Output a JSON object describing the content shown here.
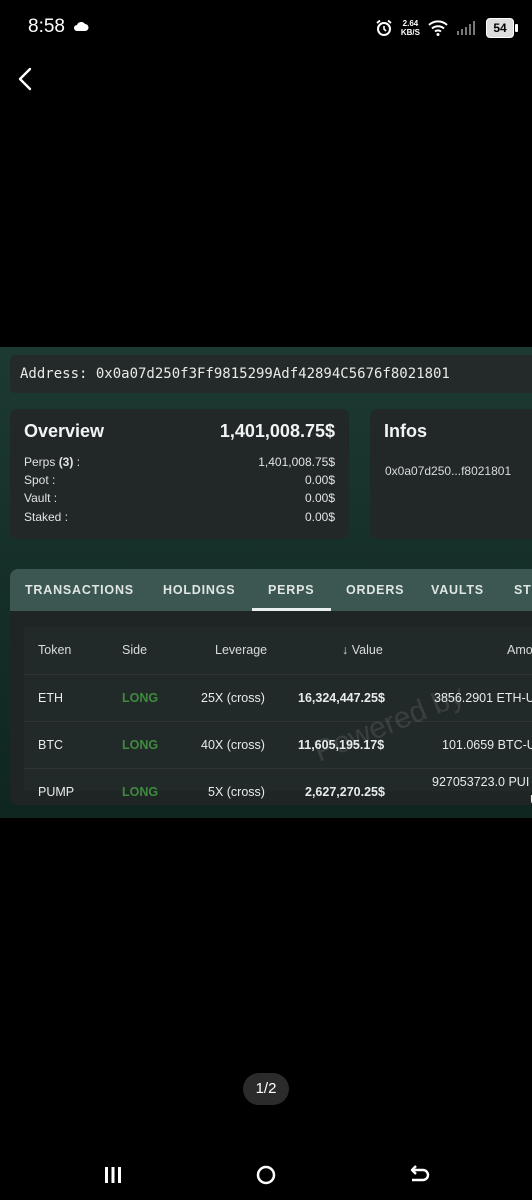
{
  "status_bar": {
    "time": "8:58",
    "net_speed_value": "2.64",
    "net_speed_unit": "KB/S",
    "battery": "54",
    "icons": [
      "cloud-icon",
      "alarm-icon",
      "wifi-icon",
      "signal-icon",
      "battery-icon"
    ]
  },
  "address": "Address: 0x0a07d250f3Ff9815299Adf42894C5676f8021801",
  "overview": {
    "title": "Overview",
    "total": "1,401,008.75$",
    "rows": [
      {
        "label_main": "Perps ",
        "label_count": "(3)",
        "label_suffix": " :",
        "value": "1,401,008.75$"
      },
      {
        "label_main": "Spot :",
        "label_count": "",
        "label_suffix": "",
        "value": "0.00$"
      },
      {
        "label_main": "Vault :",
        "label_count": "",
        "label_suffix": "",
        "value": "0.00$"
      },
      {
        "label_main": "Staked :",
        "label_count": "",
        "label_suffix": "",
        "value": "0.00$"
      }
    ]
  },
  "infos": {
    "title": "Infos",
    "address_short": "0x0a07d250...f8021801"
  },
  "tabs": [
    "TRANSACTIONS",
    "HOLDINGS",
    "PERPS",
    "ORDERS",
    "VAULTS",
    "ST"
  ],
  "active_tab": "PERPS",
  "table": {
    "headers": {
      "token": "Token",
      "side": "Side",
      "leverage": "Leverage",
      "value_arrow": "↓",
      "value": "Value",
      "amount": "Amo"
    },
    "rows": [
      {
        "token": "ETH",
        "side": "LONG",
        "leverage": "25X (cross)",
        "value": "16,324,447.25$",
        "amount_line1": "3856.2901 ETH-U",
        "amount_line2": ""
      },
      {
        "token": "BTC",
        "side": "LONG",
        "leverage": "40X (cross)",
        "value": "11,605,195.17$",
        "amount_line1": "101.0659 BTC-U",
        "amount_line2": ""
      },
      {
        "token": "PUMP",
        "side": "LONG",
        "leverage": "5X (cross)",
        "value": "2,627,270.25$",
        "amount_line1": "927053723.0 PUI",
        "amount_line2": "U"
      }
    ]
  },
  "watermark": "Powered by",
  "pager": "1/2",
  "colors": {
    "accent_green": "#3f8a3f",
    "tab_bar": "#3c5651",
    "card_bg": "#222828"
  }
}
